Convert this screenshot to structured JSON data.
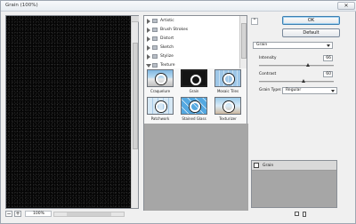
{
  "window": {
    "title": "Grain (100%)",
    "close_glyph": "✕"
  },
  "preview": {
    "zoom": "100%",
    "zoom_minus": "−",
    "zoom_plus": "+"
  },
  "filter_gallery": {
    "folders": [
      {
        "label": "Artistic",
        "expanded": false
      },
      {
        "label": "Brush Strokes",
        "expanded": false
      },
      {
        "label": "Distort",
        "expanded": false
      },
      {
        "label": "Sketch",
        "expanded": false
      },
      {
        "label": "Stylize",
        "expanded": false
      },
      {
        "label": "Texture",
        "expanded": true
      }
    ],
    "thumbnails": [
      {
        "label": "Craquelure",
        "selected": false
      },
      {
        "label": "Grain",
        "selected": true
      },
      {
        "label": "Mosaic Tiles",
        "selected": false
      },
      {
        "label": "Patchwork",
        "selected": false
      },
      {
        "label": "Stained Glass",
        "selected": false
      },
      {
        "label": "Texturizer",
        "selected": false
      }
    ]
  },
  "buttons": {
    "ok": "OK",
    "default": "Default",
    "collapse_glyph": "⌃"
  },
  "settings": {
    "filter_select": "Grain",
    "intensity": {
      "label": "Intensity",
      "value": "66",
      "fraction": 0.66
    },
    "contrast": {
      "label": "Contrast",
      "value": "60",
      "fraction": 0.6
    },
    "grain_type": {
      "label": "Grain Type:",
      "value": "Regular"
    }
  },
  "layers": [
    {
      "label": "Grain"
    }
  ],
  "colors": {
    "accent": "#3c7fb1",
    "panel": "#a6a6a6",
    "preview_bg": "#060606"
  }
}
